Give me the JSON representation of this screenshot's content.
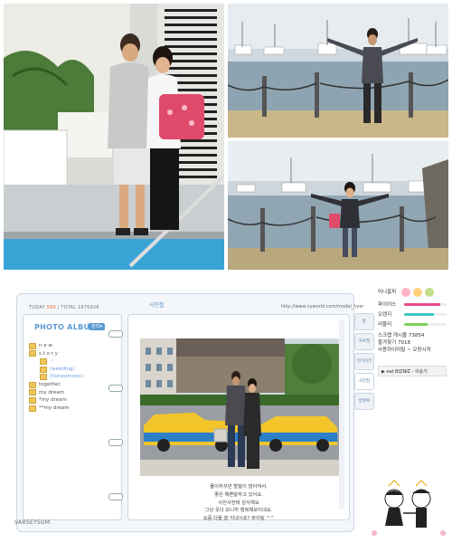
{
  "counter": {
    "today_label": "TODAY",
    "today": "599",
    "sep": "|",
    "total_label": "TOTAL",
    "total": "1676928"
  },
  "tab_title": "사진첩",
  "url": "http://www.cyworld.com/model_hyer",
  "album": {
    "title": "PHOTO ALBUM",
    "button": "관리▾",
    "folders": [
      {
        "name": "n e w",
        "sub": false
      },
      {
        "name": "s t o r y",
        "sub": false
      },
      {
        "name": "♡",
        "sub": true
      },
      {
        "name": "(wedding)",
        "sub": true
      },
      {
        "name": "(honeymoon)",
        "sub": true
      },
      {
        "name": "together",
        "sub": false
      },
      {
        "name": "my dream",
        "sub": false
      },
      {
        "name": "*my dream",
        "sub": false
      },
      {
        "name": "**my dream",
        "sub": false
      }
    ]
  },
  "photo_caption": [
    "물이자꾸만 할말이 많아져서,",
    "좋은 예쁜말하고 있어요.",
    "사진사한테 감사해요",
    "그냥 웃다 보니까 행복해보이네요.",
    "요즘 다들 잘 지내시죠? 화이팅 ^^"
  ],
  "menu_tabs": [
    "홈",
    "프로필",
    "다이어리",
    "사진첩",
    "방명록"
  ],
  "side": {
    "title": "미니홈피",
    "stats": [
      {
        "label": "파이어스",
        "value": 0.85,
        "color": "#e94b8c"
      },
      {
        "label": "오렌지",
        "value": 0.7,
        "color": "#3cc7c7"
      },
      {
        "label": "러블리",
        "value": 0.55,
        "color": "#7dd35a"
      }
    ],
    "posts": "스크랩 게시물 73854",
    "fav": "즐겨찾기 7018",
    "visit": "사용하이미털 ~ 오랑시작",
    "player": "▶ eat BIZNIZ - 이승기"
  },
  "logo": "VARSEYSUM"
}
